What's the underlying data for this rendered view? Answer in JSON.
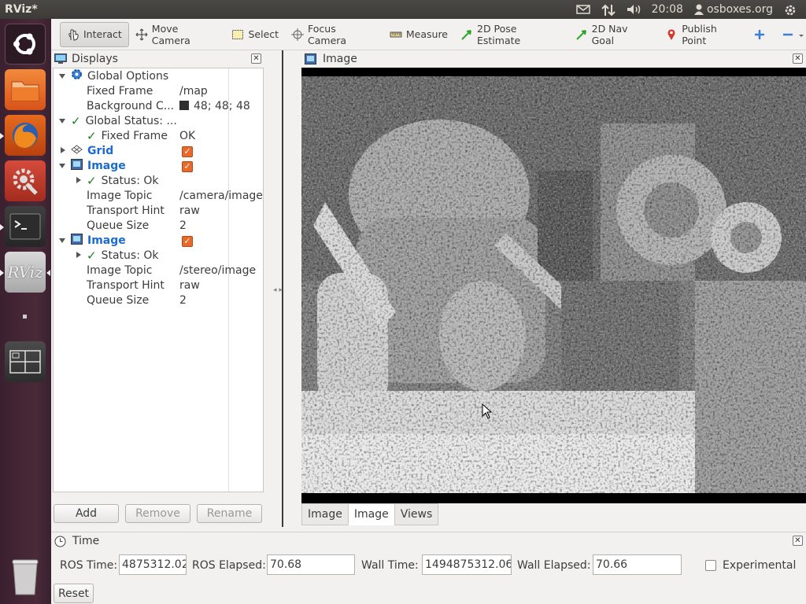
{
  "top_panel": {
    "app_title": "RViz*",
    "clock": "20:08",
    "user": "osboxes.org"
  },
  "launcher": {
    "items": [
      "dash-home",
      "files",
      "firefox",
      "system-settings",
      "terminal",
      "rviz",
      "workspace-switcher",
      "trash"
    ]
  },
  "toolbar": {
    "tools": [
      {
        "label": "Interact",
        "icon": "hand-icon"
      },
      {
        "label": "Move Camera",
        "icon": "move-camera-icon"
      },
      {
        "label": "Select",
        "icon": "select-icon"
      },
      {
        "label": "Focus Camera",
        "icon": "focus-camera-icon"
      },
      {
        "label": "Measure",
        "icon": "ruler-icon"
      },
      {
        "label": "2D Pose Estimate",
        "icon": "pose-arrow-icon"
      },
      {
        "label": "2D Nav Goal",
        "icon": "nav-goal-arrow-icon"
      },
      {
        "label": "Publish Point",
        "icon": "map-pin-icon"
      }
    ]
  },
  "displays": {
    "title": "Displays",
    "rows": [
      {
        "label": "Global Options",
        "value": ""
      },
      {
        "label": "Fixed Frame",
        "value": "/map"
      },
      {
        "label": "Background C...",
        "value": "48; 48; 48"
      },
      {
        "label": "Global Status: ...",
        "value": ""
      },
      {
        "label": "Fixed Frame",
        "value": "OK"
      },
      {
        "label": "Grid",
        "value": ""
      },
      {
        "label": "Image",
        "value": ""
      },
      {
        "label": "Status: Ok",
        "value": ""
      },
      {
        "label": "Image Topic",
        "value": "/camera/image"
      },
      {
        "label": "Transport Hint",
        "value": "raw"
      },
      {
        "label": "Queue Size",
        "value": "2"
      },
      {
        "label": "Image",
        "value": ""
      },
      {
        "label": "Status: Ok",
        "value": ""
      },
      {
        "label": "Image Topic",
        "value": "/stereo/image"
      },
      {
        "label": "Transport Hint",
        "value": "raw"
      },
      {
        "label": "Queue Size",
        "value": "2"
      }
    ],
    "buttons": {
      "add": "Add",
      "remove": "Remove",
      "rename": "Rename"
    }
  },
  "image_panel": {
    "title": "Image",
    "tabs": [
      "Image",
      "Image",
      "Views"
    ],
    "active_tab": 1
  },
  "time": {
    "title": "Time",
    "ros_time_label": "ROS Time:",
    "ros_time": "4875312.02",
    "ros_elapsed_label": "ROS Elapsed:",
    "ros_elapsed": "70.68",
    "wall_time_label": "Wall Time:",
    "wall_time": "1494875312.06",
    "wall_elapsed_label": "Wall Elapsed:",
    "wall_elapsed": "70.66",
    "experimental_label": "Experimental",
    "experimental_checked": false,
    "reset_label": "Reset"
  },
  "colors": {
    "launcher_bg": "#4a2a38",
    "accent_orange": "#e7692c",
    "link_blue": "#1c6bd0",
    "ok_green": "#1e7b1e",
    "background_swatch": "#303030"
  }
}
